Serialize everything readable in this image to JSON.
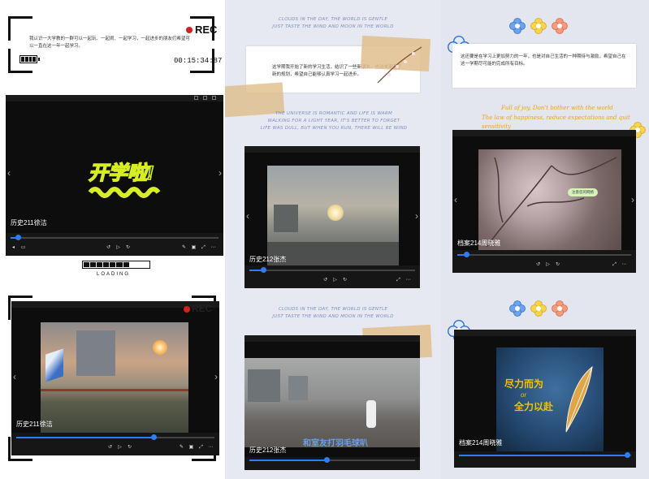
{
  "col1": {
    "rec": {
      "label": "REC",
      "timecode": "00:15:34:87"
    },
    "note": "我认识一大学教的一群可以一起玩、一起闹、一起学习，一起进步的朋友们希望可以一直在这一年一起学习。",
    "player1": {
      "title_art": "开学啦!",
      "caption": "历史211徐洁"
    },
    "loading": "LOADING",
    "rec2": {
      "label": "REC"
    },
    "player2": {
      "caption": "历史211徐洁"
    }
  },
  "col2": {
    "headline1": "CLOUDS IN THE DAY, THE WORLD IS GENTLE\nJUST TASTE THE WIND AND MOON IN THE WORLD",
    "note": "这学期我开始了新的学习生活，结识了一些新朋友，也对未来有了新的规划，希望自己能够认真学习一起进步。",
    "headline2": "THE UNIVERSE IS ROMANTIC AND LIFE IS WARM\nWALKING FOR A LIGHT YEAR, IT'S BETTER TO FORGET\nLIFE WAS DULL, BUT WHEN YOU RUN, THERE WILL BE WIND",
    "player1": {
      "caption": "历史212张杰"
    },
    "headline3": "CLOUDS IN THE DAY, THE WORLD IS GENTLE\nJUST TASTE THE WIND AND MOON IN THE WORLD",
    "player2": {
      "caption": "历史212张杰",
      "subtitle": "和室友打羽毛球叭"
    }
  },
  "col3": {
    "note": "这还要是在学习上更加努力的一年，也是对自己生活的一种期待与激励，希望自己在这一学期尽可能的完成所有目标。",
    "yellow1": "Full of joy, Don't bother with the world",
    "yellow2": "The law of happiness, reduce expectations and quit sensitivity",
    "player1": {
      "caption": "档案214周晓雅",
      "sticker": "注意您的网络"
    },
    "player2": {
      "caption": "档案214周晓雅",
      "poster_line1": "尽力而为",
      "poster_or": "or",
      "poster_line2": "全力以赴"
    }
  },
  "colors": {
    "accent": "#2e7df6",
    "rec_red": "#d61f1f",
    "poster_text": "#f2c400"
  }
}
